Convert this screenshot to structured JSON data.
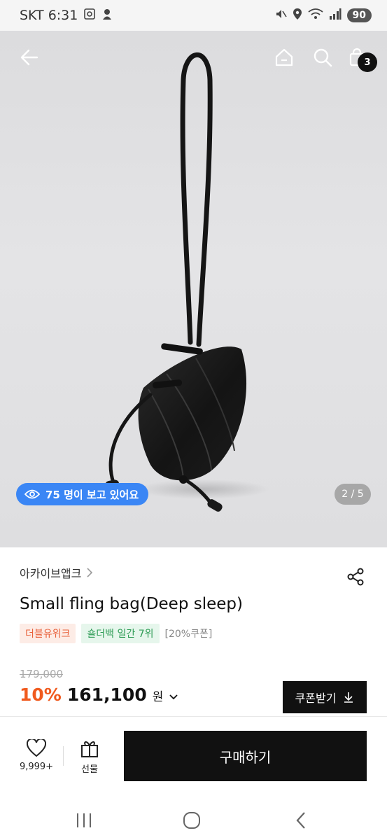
{
  "status_bar": {
    "carrier_time": "SKT 6:31",
    "battery": "90"
  },
  "header": {
    "cart_count": "3"
  },
  "gallery": {
    "viewers_text": "75 명이 보고 있어요",
    "page_indicator": "2 / 5"
  },
  "product": {
    "brand": "아카이브앱크",
    "title": "Small fling bag(Deep sleep)",
    "tags": [
      "더블유위크",
      "숄더백 일간 7위",
      "[20%쿠폰]"
    ],
    "original_price": "179,000",
    "discount": "10%",
    "price": "161,100",
    "currency": "원",
    "coupon_button": "쿠폰받기"
  },
  "action_bar": {
    "like_count": "9,999+",
    "gift_label": "선물",
    "buy_label": "구매하기"
  },
  "colors": {
    "accent_orange": "#f05a1e",
    "viewers_blue": "#3a86f5",
    "primary_black": "#111111"
  }
}
